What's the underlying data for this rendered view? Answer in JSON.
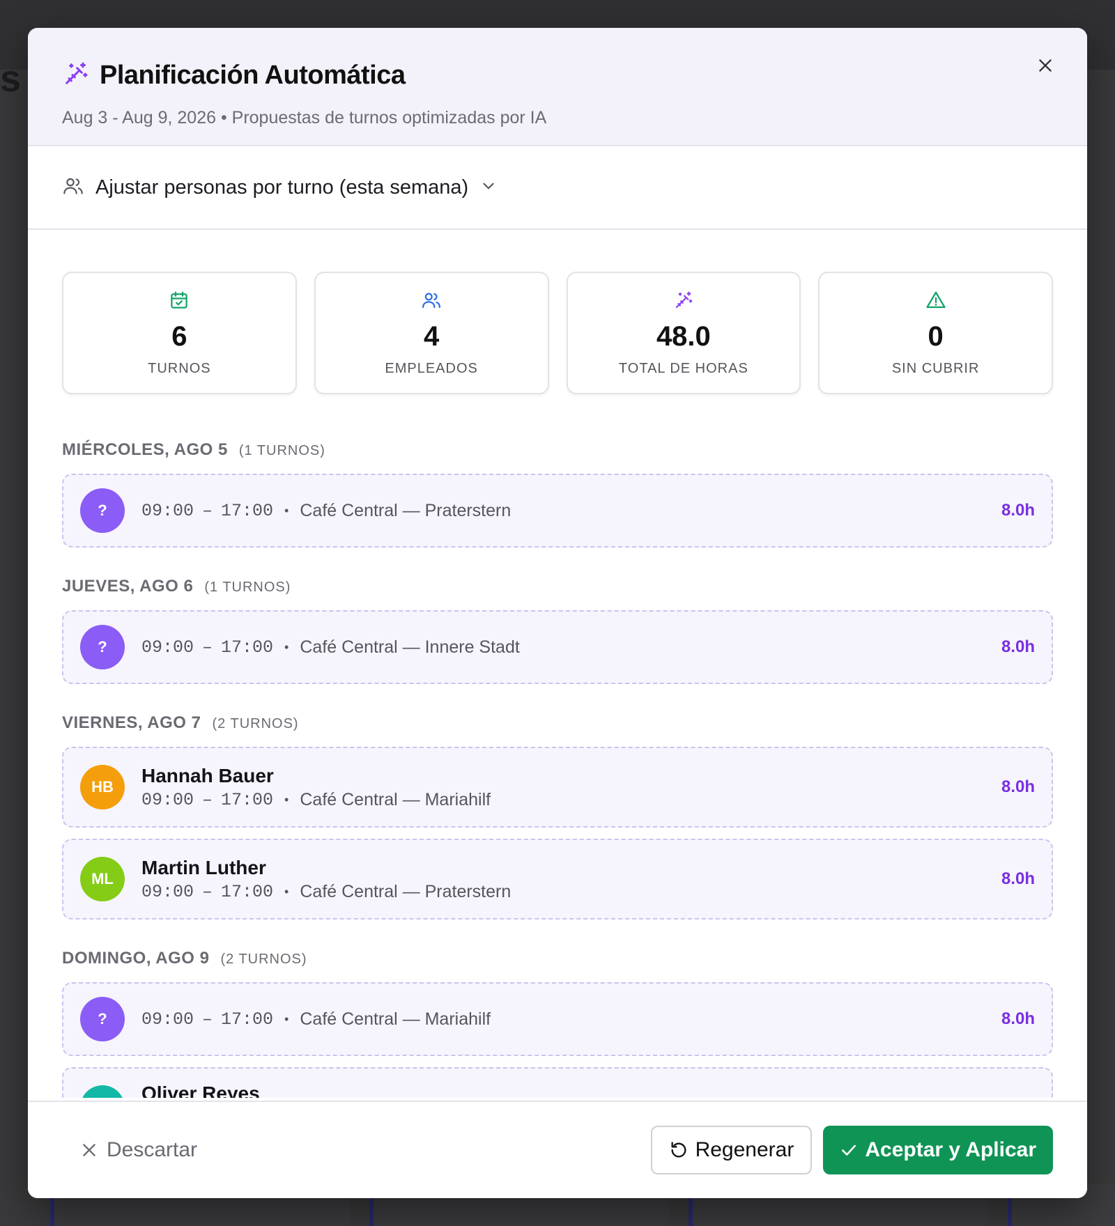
{
  "modal": {
    "title": "Planificación Automática",
    "subtitle": "Aug 3 - Aug 9, 2026 • Propuestas de turnos optimizadas por IA",
    "adjust_label": "Ajustar personas por turno (esta semana)"
  },
  "stats": [
    {
      "icon": "calendar-check-icon",
      "value": "6",
      "label": "TURNOS",
      "color": "#12a366"
    },
    {
      "icon": "users-icon",
      "value": "4",
      "label": "EMPLEADOS",
      "color": "#2f6fe0"
    },
    {
      "icon": "magic-wand-icon",
      "value": "48.0",
      "label": "TOTAL DE HORAS",
      "color": "#8a3ff0"
    },
    {
      "icon": "warning-icon",
      "value": "0",
      "label": "SIN CUBRIR",
      "color": "#12a366"
    }
  ],
  "days": [
    {
      "name": "MIÉRCOLES, AGO 5",
      "count": "(1 TURNOS)",
      "shifts": [
        {
          "initials": "?",
          "avatar_color": "#8b5cf6",
          "name": "",
          "start": "09:00",
          "dash": "–",
          "end": "17:00",
          "location": "Café Central — Praterstern",
          "hours": "8.0h"
        }
      ]
    },
    {
      "name": "JUEVES, AGO 6",
      "count": "(1 TURNOS)",
      "shifts": [
        {
          "initials": "?",
          "avatar_color": "#8b5cf6",
          "name": "",
          "start": "09:00",
          "dash": "–",
          "end": "17:00",
          "location": "Café Central — Innere Stadt",
          "hours": "8.0h"
        }
      ]
    },
    {
      "name": "VIERNES, AGO 7",
      "count": "(2 TURNOS)",
      "shifts": [
        {
          "initials": "HB",
          "avatar_color": "#f59e0b",
          "name": "Hannah Bauer",
          "start": "09:00",
          "dash": "–",
          "end": "17:00",
          "location": "Café Central — Mariahilf",
          "hours": "8.0h"
        },
        {
          "initials": "ML",
          "avatar_color": "#84cc16",
          "name": "Martin Luther",
          "start": "09:00",
          "dash": "–",
          "end": "17:00",
          "location": "Café Central — Praterstern",
          "hours": "8.0h"
        }
      ]
    },
    {
      "name": "DOMINGO, AGO 9",
      "count": "(2 TURNOS)",
      "shifts": [
        {
          "initials": "?",
          "avatar_color": "#8b5cf6",
          "name": "",
          "start": "09:00",
          "dash": "–",
          "end": "17:00",
          "location": "Café Central — Mariahilf",
          "hours": "8.0h"
        },
        {
          "initials": "",
          "avatar_color": "#14b8a6",
          "name": "Oliver Reyes",
          "start": "",
          "dash": "",
          "end": "",
          "location": "",
          "hours": ""
        }
      ]
    }
  ],
  "footer": {
    "discard_label": "Descartar",
    "regenerate_label": "Regenerar",
    "accept_label": "Aceptar y Aplicar"
  },
  "colors": {
    "accent_purple": "#7a2fe0",
    "accept_green": "#0f9456"
  }
}
